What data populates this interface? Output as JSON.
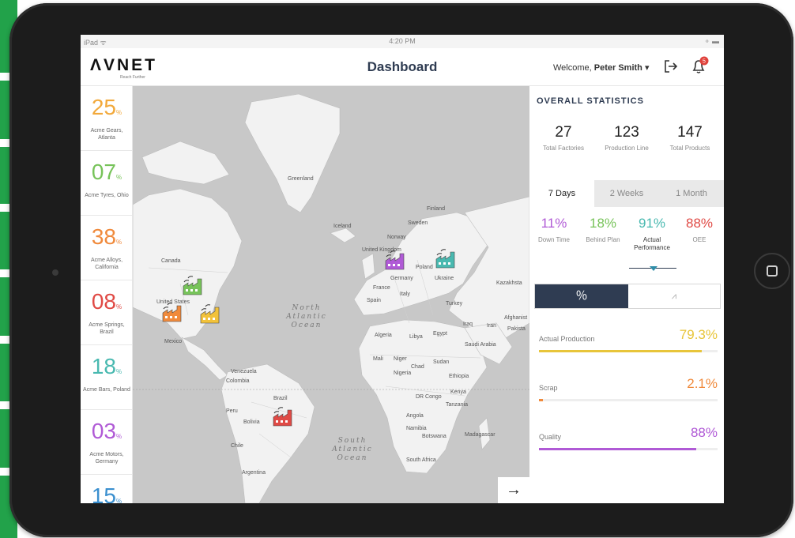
{
  "status_bar": {
    "left": "iPad ᯤ",
    "time": "4:20 PM",
    "right": "⚬ ▬"
  },
  "header": {
    "logo": "ΛVNET",
    "logo_tagline": "Reach Further",
    "title": "Dashboard",
    "welcome_prefix": "Welcome,",
    "user_name": "Peter Smith",
    "notification_count": "5"
  },
  "sidebar": {
    "items": [
      {
        "value": "25",
        "unit": "%",
        "label": "Acme Gears, Atlanta",
        "color": "#f2a93b"
      },
      {
        "value": "07",
        "unit": "%",
        "label": "Acme Tyres, Ohio",
        "color": "#77c35a"
      },
      {
        "value": "38",
        "unit": "%",
        "label": "Acme Alloys, California",
        "color": "#f08a3c"
      },
      {
        "value": "08",
        "unit": "%",
        "label": "Acme Springs, Brazil",
        "color": "#e04a45"
      },
      {
        "value": "18",
        "unit": "%",
        "label": "Acme Bars, Poland",
        "color": "#49b9b0"
      },
      {
        "value": "03",
        "unit": "%",
        "label": "Acme Motors, Germany",
        "color": "#b05ad6"
      },
      {
        "value": "15",
        "unit": "%",
        "label": "",
        "color": "#3a8fcf"
      }
    ]
  },
  "map": {
    "labels": {
      "greenland": "Greenland",
      "iceland": "Iceland",
      "canada": "Canada",
      "united_states": "United States",
      "mexico": "Mexico",
      "venezuela": "Venezuela",
      "colombia": "Colombia",
      "peru": "Peru",
      "bolivia": "Bolivia",
      "brazil": "Brazil",
      "chile": "Chile",
      "argentina": "Argentina",
      "finland": "Finland",
      "sweden": "Sweden",
      "norway": "Norway",
      "united_kingdom": "United Kingdom",
      "poland": "Poland",
      "germany": "Germany",
      "ukraine": "Ukraine",
      "france": "France",
      "spain": "Spain",
      "italy": "Italy",
      "turkey": "Turkey",
      "kazakhstan": "Kazakhsta",
      "algeria": "Algeria",
      "libya": "Libya",
      "egypt": "Egypt",
      "iraq": "Iraq",
      "iran": "Iran",
      "saudi_arabia": "Saudi Arabia",
      "afghanistan": "Afghanist",
      "pakistan": "Pakista",
      "mali": "Mali",
      "niger": "Niger",
      "chad": "Chad",
      "sudan": "Sudan",
      "nigeria": "Nigeria",
      "ethiopia": "Ethiopia",
      "dr_congo": "DR Congo",
      "kenya": "Kenya",
      "tanzania": "Tanzania",
      "angola": "Angola",
      "namibia": "Namibia",
      "botswana": "Botswana",
      "madagascar": "Madagascar",
      "south_africa": "South Africa"
    },
    "oceans": {
      "north_atlantic": "North Atlantic Ocean",
      "south_atlantic": "South Atlantic Ocean"
    },
    "factory_colors": [
      "#77c35a",
      "#f08a3c",
      "#f2c23b",
      "#b05ad6",
      "#49b9b0",
      "#e04a45"
    ],
    "next_icon": "→"
  },
  "stats": {
    "title": "OVERALL STATISTICS",
    "items": [
      {
        "value": "27",
        "label": "Total Factories"
      },
      {
        "value": "123",
        "label": "Production Line"
      },
      {
        "value": "147",
        "label": "Total Products"
      }
    ],
    "tabs": [
      "7 Days",
      "2 Weeks",
      "1 Month"
    ],
    "active_tab": "7 Days",
    "metrics": [
      {
        "value": "11%",
        "label": "Down Time",
        "color": "#b05ad6"
      },
      {
        "value": "18%",
        "label": "Behind Plan",
        "color": "#77c35a"
      },
      {
        "value": "91%",
        "label": "Actual Performance",
        "color": "#49b9b0"
      },
      {
        "value": "88%",
        "label": "OEE",
        "color": "#e04a45"
      }
    ],
    "view_toggle": {
      "percent_icon": "％",
      "chart_icon": "⩘"
    },
    "bars": [
      {
        "label": "Actual Production",
        "value": "79.3%",
        "fraction": 0.91,
        "color": "#e8c53a"
      },
      {
        "label": "Scrap",
        "value": "2.1%",
        "fraction": 0.021,
        "color": "#f08a3c"
      },
      {
        "label": "Quality",
        "value": "88%",
        "fraction": 0.88,
        "color": "#b05ad6"
      }
    ]
  }
}
